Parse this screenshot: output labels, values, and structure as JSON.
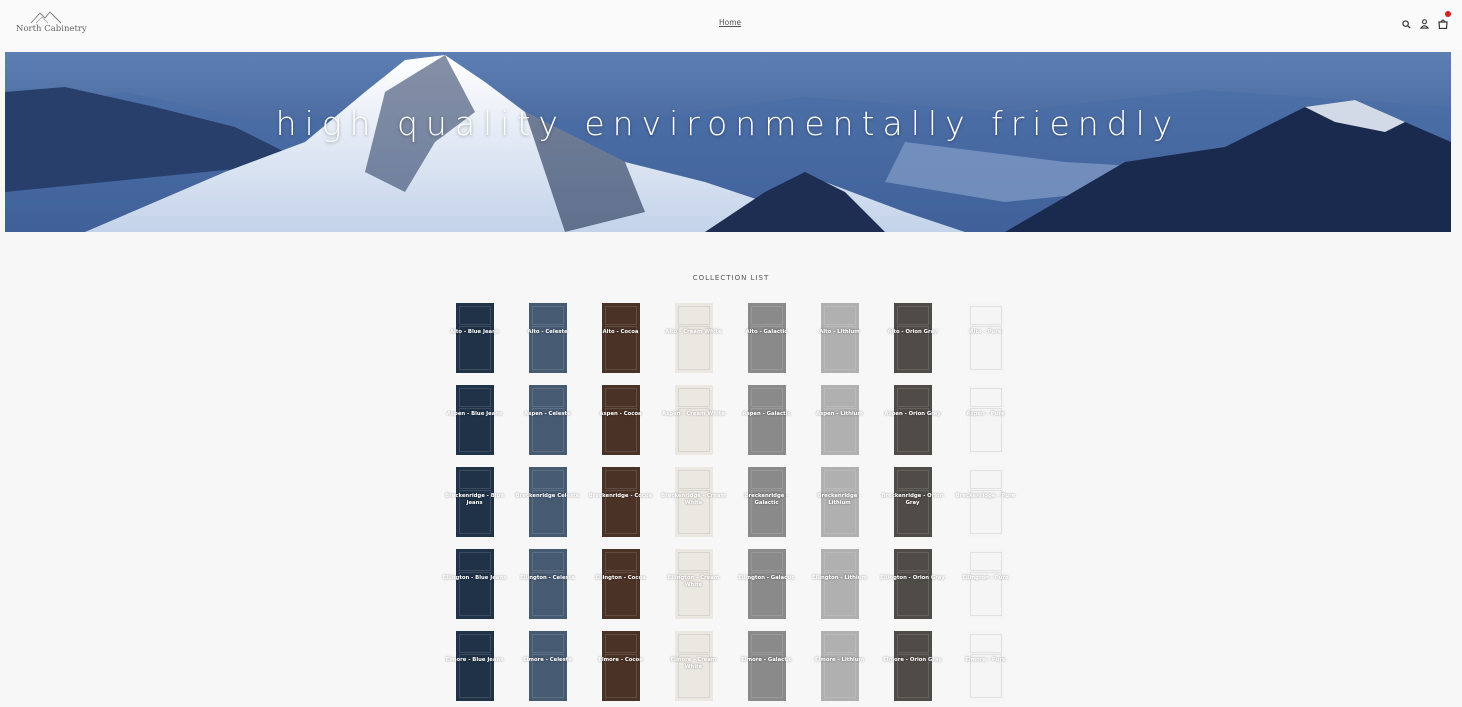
{
  "header": {
    "logo_text": "North Cabinetry",
    "nav_home": "Home",
    "icons": [
      "search-icon",
      "account-icon",
      "cart-icon"
    ]
  },
  "hero": {
    "headline": "high quality environmentally friendly"
  },
  "collection": {
    "title": "COLLECTION LIST",
    "items": [
      {
        "label": "Alto - Blue Jeans",
        "color": "#1f3247"
      },
      {
        "label": "Alto - Celeste",
        "color": "#465a72"
      },
      {
        "label": "Alto - Cocoa",
        "color": "#4a3226"
      },
      {
        "label": "Alto - Cream White",
        "color": "#ebe8e2"
      },
      {
        "label": "Alto - Galactic",
        "color": "#8a8a8a"
      },
      {
        "label": "Alto - Lithium",
        "color": "#b0b0b0"
      },
      {
        "label": "Alto - Orion Gray",
        "color": "#4f4b47"
      },
      {
        "label": "Alto - Pure",
        "color": "#f5f5f5"
      },
      {
        "label": "Aspen - Blue Jeans",
        "color": "#1f3247"
      },
      {
        "label": "Aspen - Celeste",
        "color": "#465a72"
      },
      {
        "label": "Aspen - Cocoa",
        "color": "#4a3226"
      },
      {
        "label": "Aspen - Cream White",
        "color": "#ebe8e2"
      },
      {
        "label": "Aspen - Galactic",
        "color": "#8a8a8a"
      },
      {
        "label": "Aspen - Lithium",
        "color": "#b0b0b0"
      },
      {
        "label": "Aspen - Orion Gray",
        "color": "#4f4b47"
      },
      {
        "label": "Aspen - Pure",
        "color": "#f5f5f5"
      },
      {
        "label": "Breckenridge - Blue Jeans",
        "color": "#1f3247"
      },
      {
        "label": "Breckenridge Celeste",
        "color": "#465a72"
      },
      {
        "label": "Breckenridge - Cocoa",
        "color": "#4a3226"
      },
      {
        "label": "Breckenridge - Cream White",
        "color": "#ebe8e2"
      },
      {
        "label": "Breckenridge - Galactic",
        "color": "#8a8a8a"
      },
      {
        "label": "Breckenridge - Lithium",
        "color": "#b0b0b0"
      },
      {
        "label": "Breckenridge - Orion Gray",
        "color": "#4f4b47"
      },
      {
        "label": "Breckenridge - Pure",
        "color": "#f5f5f5"
      },
      {
        "label": "Ellington - Blue Jeans",
        "color": "#1f3247"
      },
      {
        "label": "Ellington - Celeste",
        "color": "#465a72"
      },
      {
        "label": "Ellington - Cocoa",
        "color": "#4a3226"
      },
      {
        "label": "Ellington - Cream White",
        "color": "#ebe8e2"
      },
      {
        "label": "Ellington - Galactic",
        "color": "#8a8a8a"
      },
      {
        "label": "Ellington - Lithium",
        "color": "#b0b0b0"
      },
      {
        "label": "Ellington - Orion Gray",
        "color": "#4f4b47"
      },
      {
        "label": "Ellington - Pure",
        "color": "#f5f5f5"
      },
      {
        "label": "Elmore - Blue Jeans",
        "color": "#1f3247"
      },
      {
        "label": "Elmore - Celeste",
        "color": "#465a72"
      },
      {
        "label": "Elmore - Cocoa",
        "color": "#4a3226"
      },
      {
        "label": "Elmore - Cream White",
        "color": "#ebe8e2"
      },
      {
        "label": "Elmore - Galactic",
        "color": "#8a8a8a"
      },
      {
        "label": "Elmore - Lithium",
        "color": "#b0b0b0"
      },
      {
        "label": "Elmore - Orion Gray",
        "color": "#4f4b47"
      },
      {
        "label": "Elmore - Pure",
        "color": "#f5f5f5"
      }
    ]
  }
}
